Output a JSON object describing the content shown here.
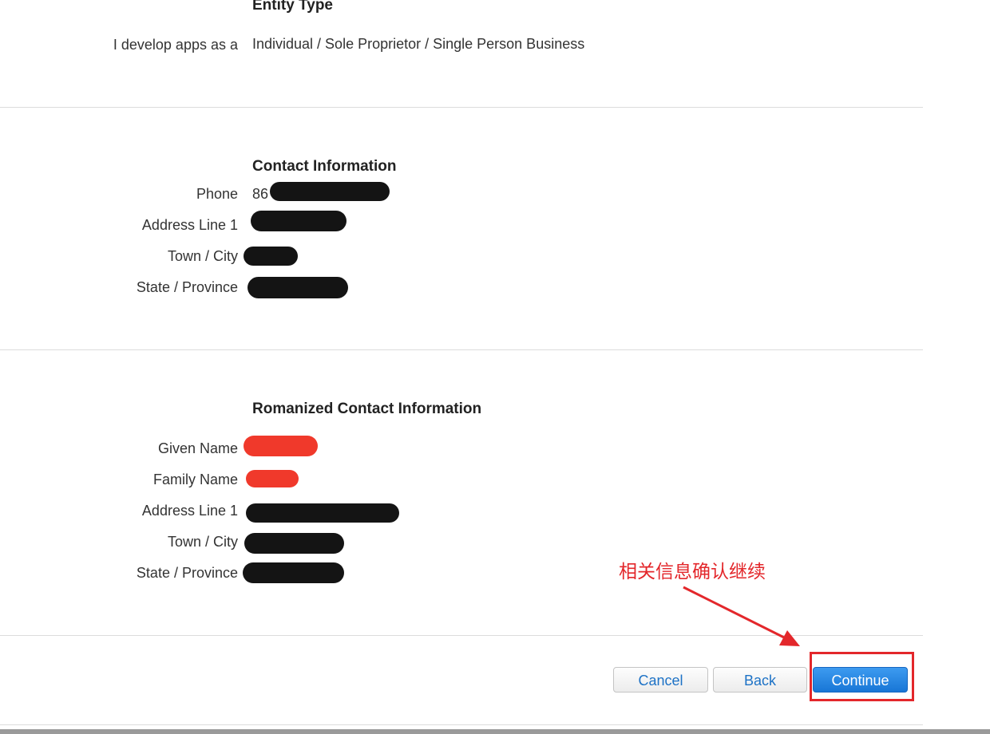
{
  "entity_section": {
    "title": "Entity Type",
    "label": "I develop apps as a",
    "value": "Individual / Sole Proprietor / Single Person Business"
  },
  "contact_section": {
    "title": "Contact Information",
    "phone_label": "Phone",
    "phone_prefix": "86",
    "address_label": "Address Line 1",
    "city_label": "Town / City",
    "state_label": "State / Province"
  },
  "romanized_section": {
    "title": "Romanized Contact Information",
    "given_name_label": "Given Name",
    "family_name_label": "Family Name",
    "address_label": "Address Line 1",
    "city_label": "Town / City",
    "state_label": "State / Province"
  },
  "buttons": {
    "cancel": "Cancel",
    "back": "Back",
    "continue": "Continue"
  },
  "annotation": {
    "text": "相关信息确认继续",
    "color": "#e3272b"
  },
  "colors": {
    "primary_button": "#1876d6",
    "link_text": "#1d72c6",
    "redaction_black": "#141414",
    "redaction_red": "#f0392b"
  }
}
